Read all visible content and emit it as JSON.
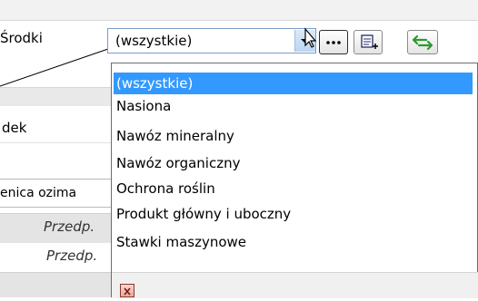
{
  "filter": {
    "label": "Środki",
    "combo_value": "(wszystkie)"
  },
  "background_form": {
    "row_label_partial": "dek",
    "crop_partial": "enica ozima",
    "item_partial_1": "Przedp.",
    "item_partial_2": "Przedp."
  },
  "dropdown": {
    "items": [
      "(wszystkie)",
      "Nasiona",
      "Nawóz mineralny",
      "Nawóz organiczny",
      "Ochrona roślin",
      "Produkt główny i uboczny",
      "Stawki maszynowe"
    ],
    "selected_index": 0
  },
  "icons": {
    "more": "ellipsis-icon",
    "add": "add-item-icon",
    "refresh": "refresh-arrows-icon",
    "dropdown": "chevron-down-icon",
    "close": "close-icon"
  },
  "colors": {
    "selection": "#3399ff",
    "combo_border": "#7a9cc8",
    "refresh_green": "#2e9a2e"
  }
}
